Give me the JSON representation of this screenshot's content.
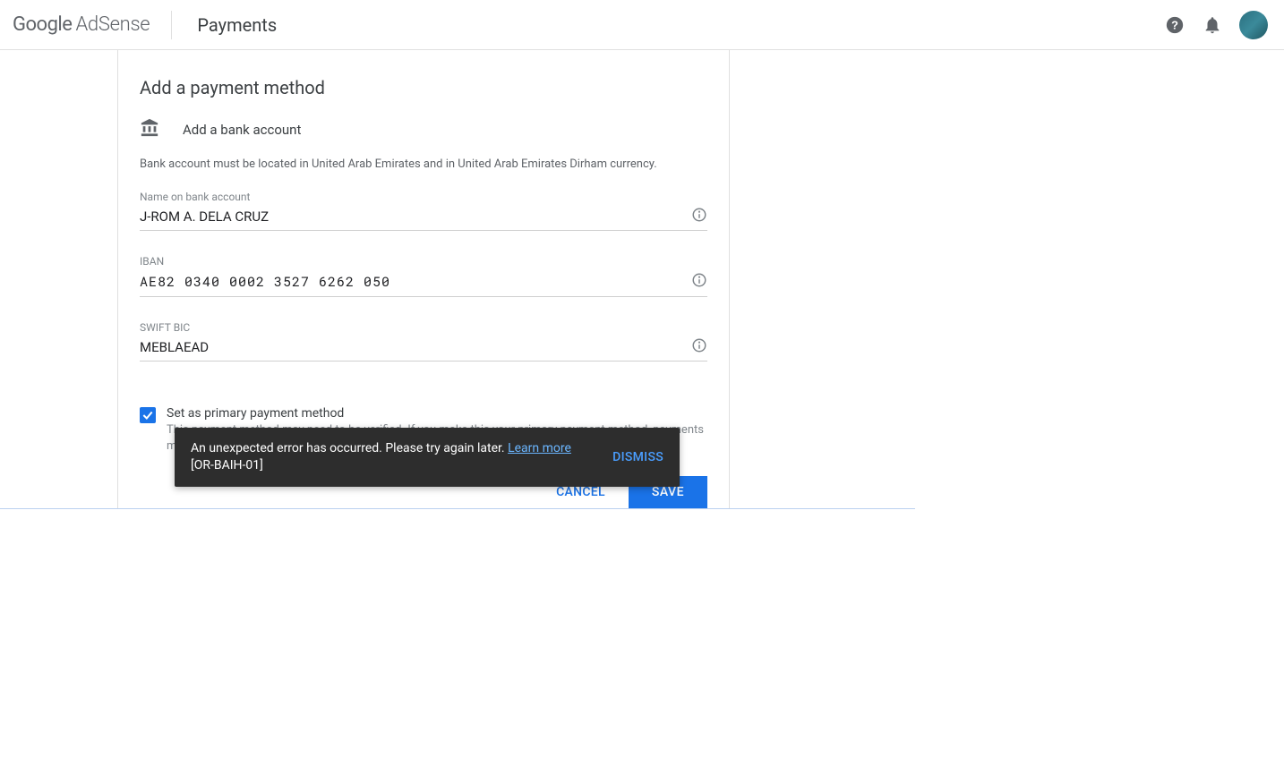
{
  "header": {
    "logo_google": "Google",
    "logo_adsense": "AdSense",
    "page_title": "Payments"
  },
  "card": {
    "title": "Add a payment method",
    "subtitle": "Add a bank account",
    "helper": "Bank account must be located in United Arab Emirates and in United Arab Emirates Dirham currency."
  },
  "fields": {
    "name_label": "Name on bank account",
    "name_value": "J-ROM A. DELA CRUZ",
    "iban_label": "IBAN",
    "iban_value": "AE82 0340 0002 3527 6262 050",
    "swift_label": "SWIFT BIC",
    "swift_value": "MEBLAEAD"
  },
  "primary": {
    "label": "Set as primary payment method",
    "helper": "This payment method may need to be verified. If you make this your primary payment method, payments ma"
  },
  "actions": {
    "cancel": "CANCEL",
    "save": "SAVE"
  },
  "toast": {
    "message": "An unexpected error has occurred. Please try again later. ",
    "learn_more": "Learn more",
    "code": "[OR-BAIH-01]",
    "dismiss": "DISMISS"
  }
}
